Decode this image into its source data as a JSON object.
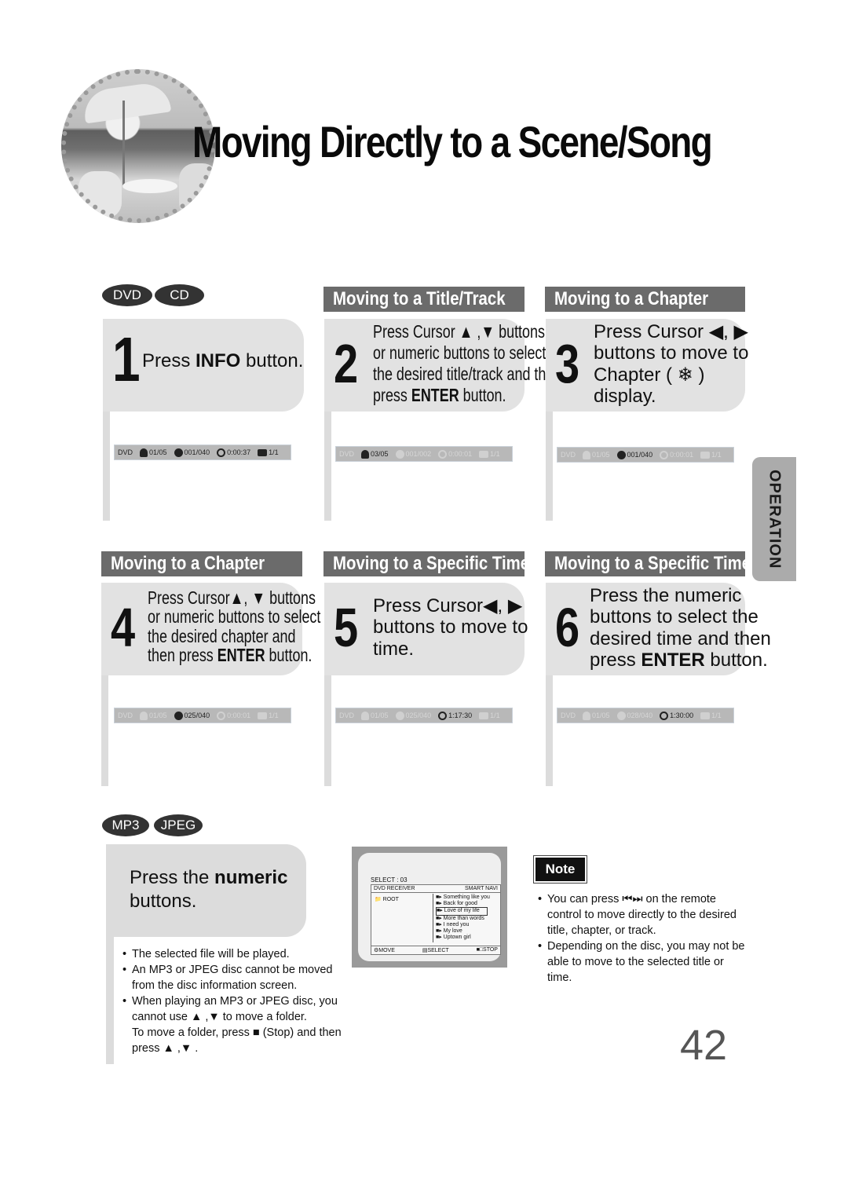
{
  "page": {
    "title": "Moving Directly to a Scene/Song",
    "page_number": "42",
    "side_tab": "OPERATION"
  },
  "badges": {
    "dvd": "DVD",
    "cd": "CD",
    "mp3": "MP3",
    "jpeg": "JPEG"
  },
  "sections": {
    "title_track": "Moving to a Title/Track",
    "chapter_top": "Moving to a Chapter",
    "chapter_bottom": "Moving to a Chapter",
    "time_mid": "Moving to a Specific Time",
    "time_right": "Moving to a Specific Time"
  },
  "steps": [
    {
      "num": "1",
      "lines": [
        "Press ",
        "INFO",
        " button."
      ]
    },
    {
      "num": "2",
      "lines": [
        "Press Cursor ▲ ,▼  buttons",
        "or numeric buttons to select",
        "the desired title/track and then",
        "press ",
        "ENTER",
        " button."
      ]
    },
    {
      "num": "3",
      "lines": [
        "Press Cursor ◀, ▶",
        "buttons to move to",
        "Chapter ( ❄ )",
        "display."
      ]
    },
    {
      "num": "4",
      "lines": [
        "Press Cursor▲, ▼ buttons",
        "or numeric buttons to select",
        "the desired chapter and",
        "then press ",
        "ENTER",
        " button."
      ]
    },
    {
      "num": "5",
      "lines": [
        "Press Cursor◀, ▶",
        "buttons to move to",
        "time."
      ]
    },
    {
      "num": "6",
      "lines": [
        "Press the numeric",
        "buttons to select the",
        "desired time and then",
        "press ",
        "ENTER",
        " button."
      ]
    }
  ],
  "infobars": [
    {
      "disc": "DVD",
      "title": "01/05",
      "chapter": "001/040",
      "time": "0:00:37",
      "angle": "1/1",
      "active": "all"
    },
    {
      "disc": "DVD",
      "title": "03/05",
      "chapter": "001/002",
      "time": "0:00:01",
      "angle": "1/1",
      "active": "title"
    },
    {
      "disc": "DVD",
      "title": "01/05",
      "chapter": "001/040",
      "time": "0:00:01",
      "angle": "1/1",
      "active": "chapter"
    },
    {
      "disc": "DVD",
      "title": "01/05",
      "chapter": "025/040",
      "time": "0:00:01",
      "angle": "1/1",
      "active": "chapter"
    },
    {
      "disc": "DVD",
      "title": "01/05",
      "chapter": "025/040",
      "time": "1:17:30",
      "angle": "1/1",
      "active": "time"
    },
    {
      "disc": "DVD",
      "title": "01/05",
      "chapter": "028/040",
      "time": "1:30:00",
      "angle": "1/1",
      "active": "time"
    }
  ],
  "mp3": {
    "instruction_pre": "Press the ",
    "instruction_bold": "numeric",
    "instruction_post": "buttons.",
    "bullets": [
      "The selected file will be played.",
      "An MP3 or JPEG disc cannot be moved from the disc information screen.",
      "When playing an MP3 or JPEG disc, you cannot use ▲ ,▼  to move a folder.",
      "To move a folder, press ■ (Stop) and then press ▲ ,▼  ."
    ]
  },
  "screen": {
    "select_label": "SELECT :",
    "select_value": "03",
    "header_left": "DVD RECEIVER",
    "header_right": "SMART NAVI",
    "root": "ROOT",
    "tracks": [
      "Something like you",
      "Back for good",
      "Love of my life",
      "More than words",
      "I need you",
      "My love",
      "Uptown girl"
    ],
    "highlighted_track": "Love of my life",
    "footer": {
      "move": "MOVE",
      "select": "SELECT",
      "stop": "STOP"
    }
  },
  "note": {
    "label": "Note",
    "bullets": [
      "You can press ⏮⏭ on the remote control to move directly to the desired title, chapter, or track.",
      "Depending on the disc, you may not be able to move to the selected title or time."
    ]
  }
}
